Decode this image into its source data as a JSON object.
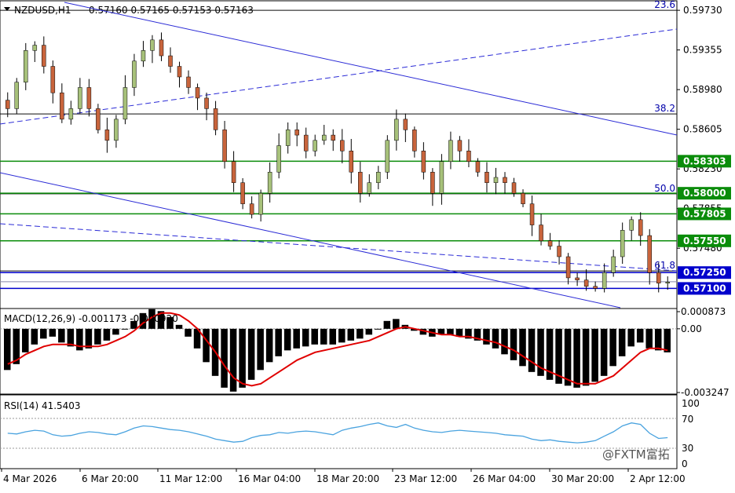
{
  "header": {
    "symbol": "NZDUSD,H1",
    "ohlc": "0.57160 0.57165 0.57153 0.57163"
  },
  "colors": {
    "bull": "#a7c17a",
    "bear": "#c8643c",
    "wick": "#000000",
    "trend": "#2b2bd6",
    "fib": "#0000aa",
    "green_level": "#0a8c0a",
    "blue_level": "#0000cc",
    "macd_signal": "#e00000",
    "macd_hist": "#000000",
    "rsi": "#4aa3df"
  },
  "price_axis": {
    "ticks": [
      "0.59730",
      "0.59355",
      "0.58980",
      "0.58605",
      "0.58230",
      "0.57855",
      "0.57480"
    ],
    "ylim": [
      0.5691,
      0.5982
    ]
  },
  "fib_labels": [
    "23.6",
    "38.2",
    "50.0",
    "61.8"
  ],
  "level_badges": [
    {
      "label": "0.58303",
      "value": 0.58303,
      "kind": "green"
    },
    {
      "label": "0.58000",
      "value": 0.58,
      "kind": "green"
    },
    {
      "label": "0.57805",
      "value": 0.57805,
      "kind": "green"
    },
    {
      "label": "0.57550",
      "value": 0.5755,
      "kind": "green"
    },
    {
      "label": "0.57250",
      "value": 0.5725,
      "kind": "blue"
    },
    {
      "label": "0.57100",
      "value": 0.571,
      "kind": "blue"
    }
  ],
  "macd": {
    "label": "MACD(12,26,9) -0.001173 -0.000920",
    "ticks": [
      "0.000873",
      "0.00",
      "-0.003247"
    ]
  },
  "rsi": {
    "label": "RSI(14) 41.5403",
    "ticks": [
      "100",
      "70",
      "30",
      "0"
    ]
  },
  "x_labels": [
    "4 Mar 2026",
    "6 Mar 20:00",
    "11 Mar 12:00",
    "16 Mar 04:00",
    "18 Mar 20:00",
    "23 Mar 12:00",
    "26 Mar 04:00",
    "30 Mar 20:00",
    "2 Apr 12:00"
  ],
  "watermark": "@FXTM富拓",
  "chart_data": {
    "type": "candlestick",
    "title": "NZDUSD,H1",
    "ylim": [
      0.5691,
      0.5982
    ],
    "fib_levels": [
      {
        "label": "23.6",
        "value": 0.5973
      },
      {
        "label": "38.2",
        "value": 0.5875
      },
      {
        "label": "50.0",
        "value": 0.57995
      },
      {
        "label": "61.8",
        "value": 0.57265
      }
    ],
    "horizontal_levels": [
      0.58303,
      0.58,
      0.57805,
      0.5755,
      0.5725,
      0.571
    ],
    "price_series": [
      0.588,
      0.5905,
      0.5935,
      0.594,
      0.592,
      0.5895,
      0.587,
      0.588,
      0.59,
      0.588,
      0.586,
      0.585,
      0.587,
      0.59,
      0.5925,
      0.5935,
      0.5945,
      0.593,
      0.592,
      0.591,
      0.59,
      0.589,
      0.588,
      0.586,
      0.583,
      0.581,
      0.579,
      0.578,
      0.58,
      0.582,
      0.5845,
      0.586,
      0.5855,
      0.584,
      0.585,
      0.5855,
      0.585,
      0.584,
      0.582,
      0.58,
      0.581,
      0.582,
      0.585,
      0.587,
      0.586,
      0.584,
      0.582,
      0.58,
      0.583,
      0.585,
      0.584,
      0.583,
      0.582,
      0.581,
      0.5815,
      0.581,
      0.58,
      0.579,
      0.577,
      0.5755,
      0.575,
      0.574,
      0.572,
      0.5718,
      0.5712,
      0.571,
      0.5725,
      0.574,
      0.5765,
      0.5775,
      0.576,
      0.5725,
      0.5715,
      0.5716
    ]
  },
  "macd_data": {
    "hist": [
      -0.0021,
      -0.0018,
      -0.0012,
      -0.0008,
      -0.0005,
      -0.0004,
      -0.0007,
      -0.0009,
      -0.0011,
      -0.001,
      -0.0008,
      -0.0006,
      -0.0003,
      0.0,
      0.0004,
      0.0008,
      0.001,
      0.0009,
      0.0006,
      0.0002,
      -0.0004,
      -0.001,
      -0.0017,
      -0.0024,
      -0.003,
      -0.0032,
      -0.003,
      -0.0026,
      -0.0021,
      -0.0017,
      -0.0014,
      -0.0011,
      -0.001,
      -0.0009,
      -0.0008,
      -0.0008,
      -0.0008,
      -0.0007,
      -0.0006,
      -0.0005,
      -0.0003,
      0.0,
      0.0004,
      0.0005,
      0.0002,
      -0.0001,
      -0.0003,
      -0.0004,
      -0.0003,
      -0.0003,
      -0.0004,
      -0.0005,
      -0.0006,
      -0.0008,
      -0.001,
      -0.0013,
      -0.0016,
      -0.0019,
      -0.0022,
      -0.0024,
      -0.0026,
      -0.0028,
      -0.0029,
      -0.003,
      -0.0029,
      -0.0027,
      -0.0024,
      -0.0019,
      -0.0014,
      -0.0009,
      -0.0007,
      -0.001,
      -0.0011,
      -0.0012
    ],
    "signal": [
      -0.0018,
      -0.0016,
      -0.0013,
      -0.0011,
      -0.0009,
      -0.0008,
      -0.0008,
      -0.0008,
      -0.0009,
      -0.0009,
      -0.0009,
      -0.0008,
      -0.0006,
      -0.0004,
      -0.0001,
      0.0003,
      0.0006,
      0.0008,
      0.0008,
      0.0007,
      0.0004,
      0.0,
      -0.0006,
      -0.0012,
      -0.0019,
      -0.0025,
      -0.0028,
      -0.0029,
      -0.0028,
      -0.0025,
      -0.0022,
      -0.0019,
      -0.0016,
      -0.0014,
      -0.0012,
      -0.0011,
      -0.001,
      -0.0009,
      -0.0008,
      -0.0007,
      -0.0006,
      -0.0004,
      -0.0002,
      0.0,
      0.0001,
      0.0,
      -0.0001,
      -0.0002,
      -0.0003,
      -0.0003,
      -0.0004,
      -0.0004,
      -0.0005,
      -0.0006,
      -0.0007,
      -0.0009,
      -0.0011,
      -0.0014,
      -0.0017,
      -0.002,
      -0.0022,
      -0.0024,
      -0.0026,
      -0.0028,
      -0.0028,
      -0.0028,
      -0.0026,
      -0.0024,
      -0.002,
      -0.0016,
      -0.0012,
      -0.001,
      -0.001,
      -0.0011
    ]
  },
  "rsi_data": [
    48,
    47,
    50,
    52,
    51,
    46,
    44,
    45,
    48,
    50,
    49,
    47,
    46,
    50,
    55,
    58,
    57,
    55,
    53,
    52,
    50,
    47,
    44,
    40,
    38,
    36,
    37,
    42,
    45,
    46,
    49,
    48,
    50,
    51,
    50,
    48,
    46,
    52,
    55,
    57,
    60,
    62,
    58,
    56,
    60,
    55,
    52,
    50,
    49,
    51,
    52,
    51,
    50,
    49,
    48,
    46,
    45,
    44,
    40,
    38,
    39,
    37,
    36,
    35,
    36,
    38,
    44,
    50,
    58,
    62,
    60,
    48,
    41,
    42
  ]
}
